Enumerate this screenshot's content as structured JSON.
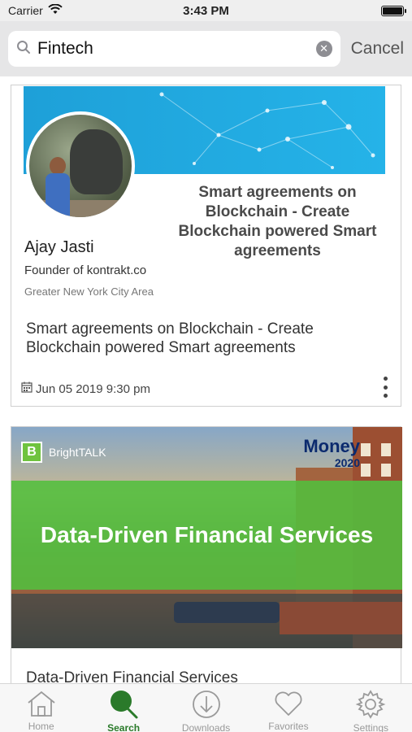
{
  "status_bar": {
    "carrier": "Carrier",
    "time": "3:43 PM"
  },
  "search": {
    "query": "Fintech",
    "cancel_label": "Cancel"
  },
  "cards": [
    {
      "banner_title": "Smart agreements on Blockchain - Create Blockchain powered Smart agreements",
      "speaker_name": "Ajay Jasti",
      "speaker_role": "Founder of kontrakt.co",
      "speaker_location": "Greater New York City Area",
      "title": "Smart agreements on Blockchain - Create Blockchain powered Smart agreements",
      "date": "Jun 05 2019 9:30 pm"
    },
    {
      "brand_name": "BrightTALK",
      "brand_initial": "B",
      "event_logo": "Money",
      "event_year": "2020",
      "banner_title": "Data-Driven Financial Services",
      "title": "Data-Driven Financial Services"
    }
  ],
  "tabs": [
    {
      "label": "Home",
      "icon": "home-icon"
    },
    {
      "label": "Search",
      "icon": "search-icon"
    },
    {
      "label": "Downloads",
      "icon": "download-icon"
    },
    {
      "label": "Favorites",
      "icon": "heart-icon"
    },
    {
      "label": "Settings",
      "icon": "gear-icon"
    }
  ],
  "colors": {
    "active_tab": "#2a7a2a",
    "accent_green": "#52bf3e",
    "banner_blue": "#1ea0d8"
  }
}
